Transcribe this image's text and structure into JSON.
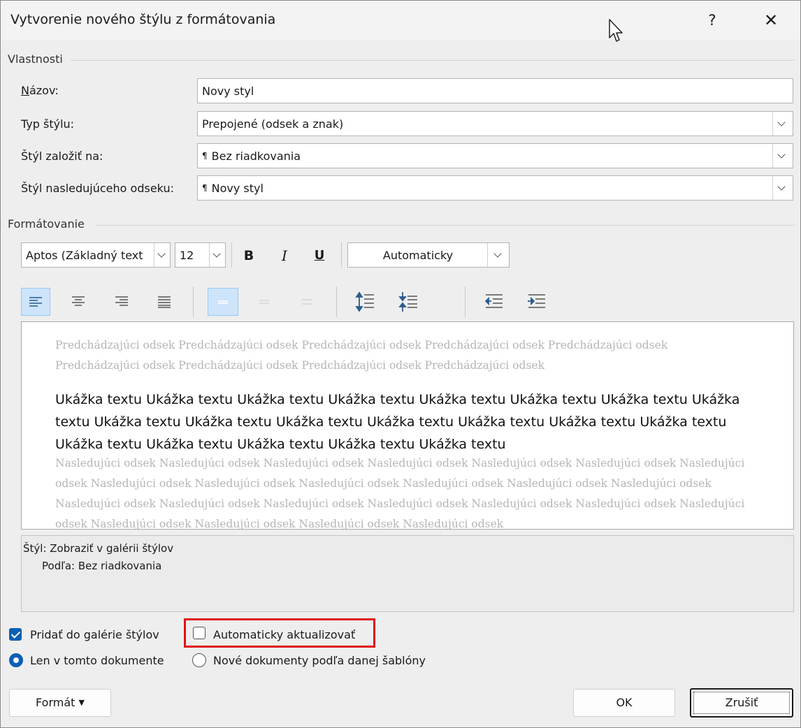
{
  "title": "Vytvorenie nového štýlu z formátovania",
  "help": "?",
  "close": "✕",
  "properties": {
    "heading": "Vlastnosti",
    "name_label": "Názov:",
    "name_value": "Novy styl",
    "type_label": "Typ štýlu:",
    "type_value": "Prepojené (odsek a znak)",
    "based_label": "Štýl založiť na:",
    "based_value": "Bez riadkovania",
    "next_label": "Štýl nasledujúceho odseku:",
    "next_value": "Novy styl",
    "paragraph_mark": "¶"
  },
  "formatting": {
    "heading": "Formátovanie",
    "font": "Aptos (Základný text",
    "size": "12",
    "bold": "B",
    "italic": "I",
    "underline": "U",
    "color": "Automaticky"
  },
  "preview": {
    "previous": "Predchádzajúci odsek Predchádzajúci odsek Predchádzajúci odsek Predchádzajúci odsek Predchádzajúci odsek Predchádzajúci odsek Predchádzajúci odsek Predchádzajúci odsek Predchádzajúci odsek",
    "sample": "Ukážka textu Ukážka textu Ukážka textu Ukážka textu Ukážka textu Ukážka textu Ukážka textu Ukážka textu Ukážka textu Ukážka textu Ukážka textu Ukážka textu Ukážka textu Ukážka textu Ukážka textu Ukážka textu Ukážka textu Ukážka textu Ukážka textu Ukážka textu",
    "next": "Nasledujúci odsek Nasledujúci odsek Nasledujúci odsek Nasledujúci odsek Nasledujúci odsek Nasledujúci odsek Nasledujúci odsek Nasledujúci odsek Nasledujúci odsek Nasledujúci odsek Nasledujúci odsek Nasledujúci odsek Nasledujúci odsek Nasledujúci odsek Nasledujúci odsek Nasledujúci odsek Nasledujúci odsek Nasledujúci odsek Nasledujúci odsek Nasledujúci odsek Nasledujúci odsek Nasledujúci odsek Nasledujúci odsek Nasledujúci odsek"
  },
  "description": {
    "line1": "Štýl: Zobraziť v galérii štýlov",
    "line2": "Podľa: Bez riadkovania"
  },
  "options": {
    "add_gallery": "Pridať do galérie štýlov",
    "auto_update": "Automaticky aktualizovať",
    "only_document": "Len v tomto dokumente",
    "new_documents": "Nové dokumenty podľa danej šablóny"
  },
  "buttons": {
    "format": "Formát",
    "ok": "OK",
    "cancel": "Zrušiť"
  },
  "colors": {
    "accent": "#0a5fb4",
    "highlight": "#e01313",
    "active_tool": "#cde4fb"
  }
}
